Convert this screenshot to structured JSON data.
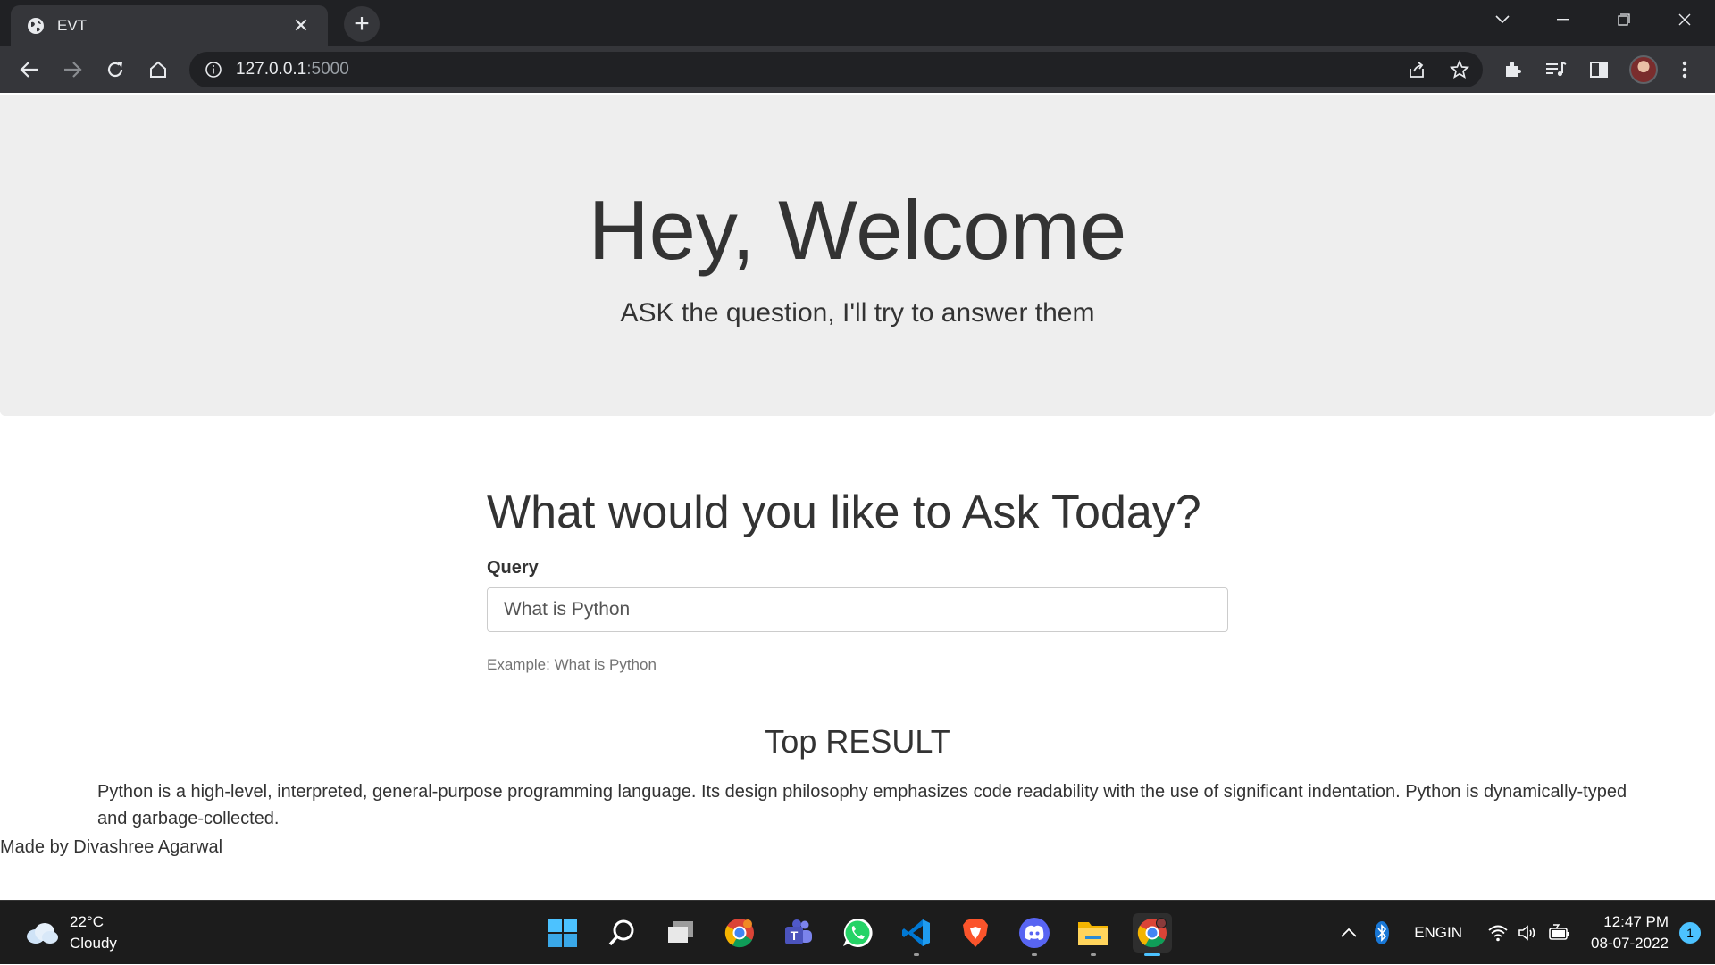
{
  "browser": {
    "tab_title": "EVT",
    "url_host": "127.0.0.1",
    "url_port": ":5000"
  },
  "page": {
    "hero_title": "Hey, Welcome",
    "hero_subtitle": "ASK the question, I'll try to answer them",
    "ask_heading": "What would you like to Ask Today?",
    "query_label": "Query",
    "query_value": "What is Python",
    "query_help": "Example: What is Python",
    "result_heading": "Top RESULT",
    "result_text": "Python is a high-level, interpreted, general-purpose programming language. Its design philosophy emphasizes code readability with the use of significant indentation. Python is dynamically-typed and garbage-collected.",
    "footer": "Made by Divashree Agarwal"
  },
  "taskbar": {
    "weather_temp": "22°C",
    "weather_desc": "Cloudy",
    "apps": [
      "start-icon",
      "search-icon",
      "task-view-icon",
      "chrome-icon",
      "teams-icon",
      "whatsapp-icon",
      "vscode-icon",
      "brave-icon",
      "discord-icon",
      "file-explorer-icon",
      "chrome-active-icon"
    ],
    "lang_top": "ENG",
    "lang_bottom": "IN",
    "time": "12:47 PM",
    "date": "08-07-2022",
    "notifications": "1"
  },
  "colors": {
    "accent": "#4cc2ff",
    "hero_bg": "#eeeeee",
    "text": "#333333"
  }
}
